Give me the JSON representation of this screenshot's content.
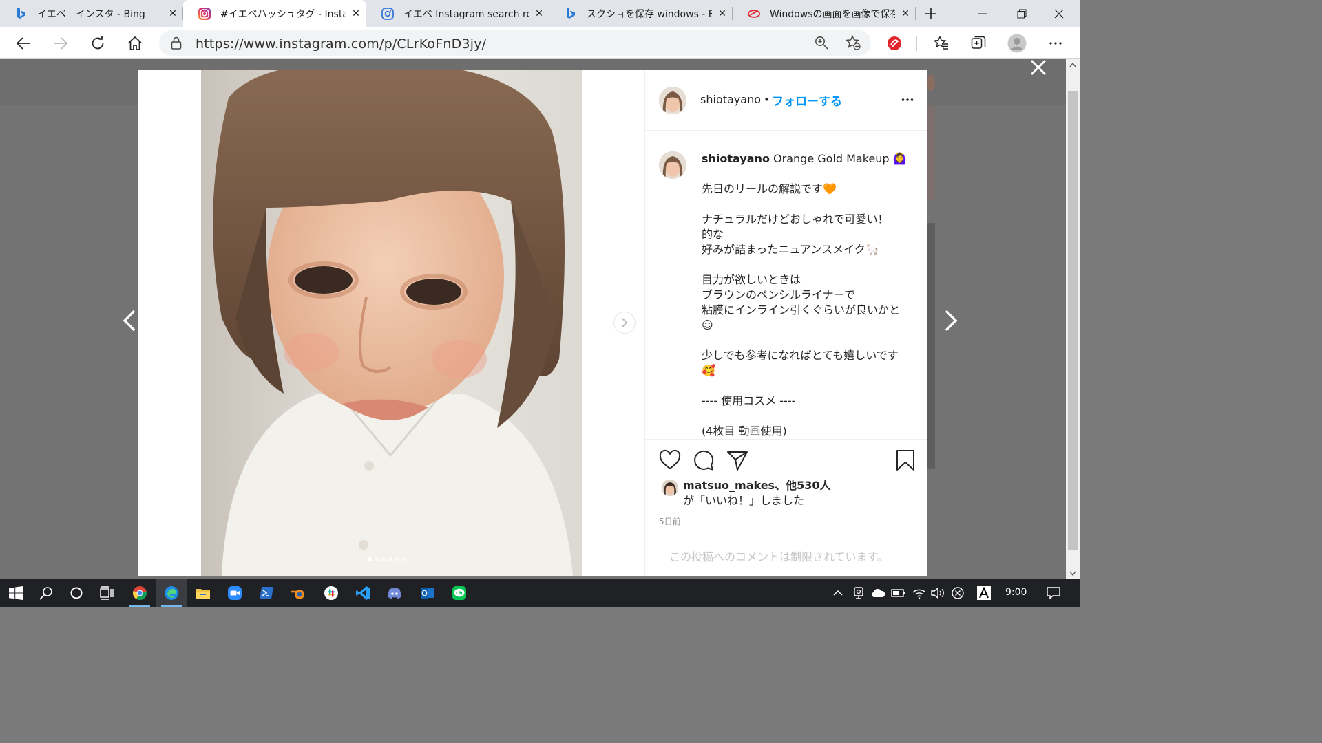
{
  "browser": {
    "tabs": [
      {
        "title": "イエベ　インスタ - Bing",
        "favicon": "bing-icon",
        "active": false
      },
      {
        "title": "#イエベハッシュタグ - Instagram",
        "favicon": "instagram-icon",
        "active": true
      },
      {
        "title": "イエベ Instagram search results",
        "favicon": "instagram-icon",
        "active": false
      },
      {
        "title": "スクショを保存 windows - Bing",
        "favicon": "bing-icon",
        "active": false
      },
      {
        "title": "Windowsの画面を画像で保存",
        "favicon": "app-icon",
        "active": false
      }
    ],
    "tab_close_glyph": "✕",
    "url": "https://www.instagram.com/p/CLrKoFnD3jy/"
  },
  "post": {
    "author": "shiotayano",
    "follow_label": "フォローする",
    "separator": "•",
    "caption_title": "Orange Gold Makeup 🙆‍♀️",
    "caption_paragraphs": [
      "先日のリールの解説です🧡",
      "ナチュラルだけどおしゃれで可愛い！\n的な\n好みが詰まったニュアンスメイク🦙",
      "目力が欲しいときは\nブラウンのペンシルライナーで\n粘膜にインライン引くぐらいが良いかと☺",
      "少しでも参考になればとても嬉しいです🥰",
      "---- 使用コスメ ----",
      "(4枚目 動画使用)"
    ],
    "liked_by_user": "matsuo_makes",
    "liked_by_others": "、他530人",
    "liked_suffix": "が「いいね！」しました",
    "time_ago": "5日前",
    "comments_restricted": "この投稿へのコメントは制限されています。",
    "carousel_count": 6,
    "carousel_index": 1
  },
  "taskbar": {
    "clock": "9:00"
  },
  "colors": {
    "instagram_blue": "#0095f6",
    "overlay": "#737373",
    "taskbar": "#202124"
  }
}
